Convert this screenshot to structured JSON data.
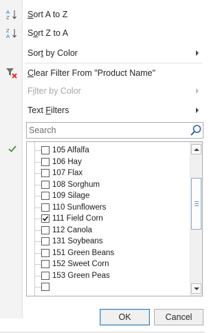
{
  "menu": {
    "sort_az": {
      "pre": "",
      "key": "S",
      "post": "ort A to Z"
    },
    "sort_za": {
      "pre": "S",
      "key": "o",
      "post": "rt Z to A"
    },
    "sort_color": {
      "pre": "Sor",
      "key": "t",
      "post": " by Color"
    },
    "clear_filter": {
      "pre": "",
      "key": "C",
      "post": "lear Filter From \"Product Name\""
    },
    "filter_color": {
      "pre": "F",
      "key": "i",
      "post": "lter by Color"
    },
    "text_filters": {
      "pre": "Text ",
      "key": "F",
      "post": "ilters"
    }
  },
  "search": {
    "placeholder": "Search"
  },
  "list": {
    "items": [
      {
        "label": "105 Alfalfa",
        "checked": false
      },
      {
        "label": "106 Hay",
        "checked": false
      },
      {
        "label": "107 Flax",
        "checked": false
      },
      {
        "label": "108 Sorghum",
        "checked": false
      },
      {
        "label": "109 Silage",
        "checked": false
      },
      {
        "label": "110 Sunflowers",
        "checked": false
      },
      {
        "label": "111 Field Corn",
        "checked": true
      },
      {
        "label": "112 Canola",
        "checked": false
      },
      {
        "label": "131 Soybeans",
        "checked": false
      },
      {
        "label": "151 Green Beans",
        "checked": false
      },
      {
        "label": "152 Sweet Corn",
        "checked": false
      },
      {
        "label": "153 Green Peas",
        "checked": false
      }
    ]
  },
  "buttons": {
    "ok": "OK",
    "cancel": "Cancel"
  },
  "colors": {
    "accent": "#2b73b8",
    "clear_x": "#d9352b",
    "check": "#4a8f3c"
  }
}
